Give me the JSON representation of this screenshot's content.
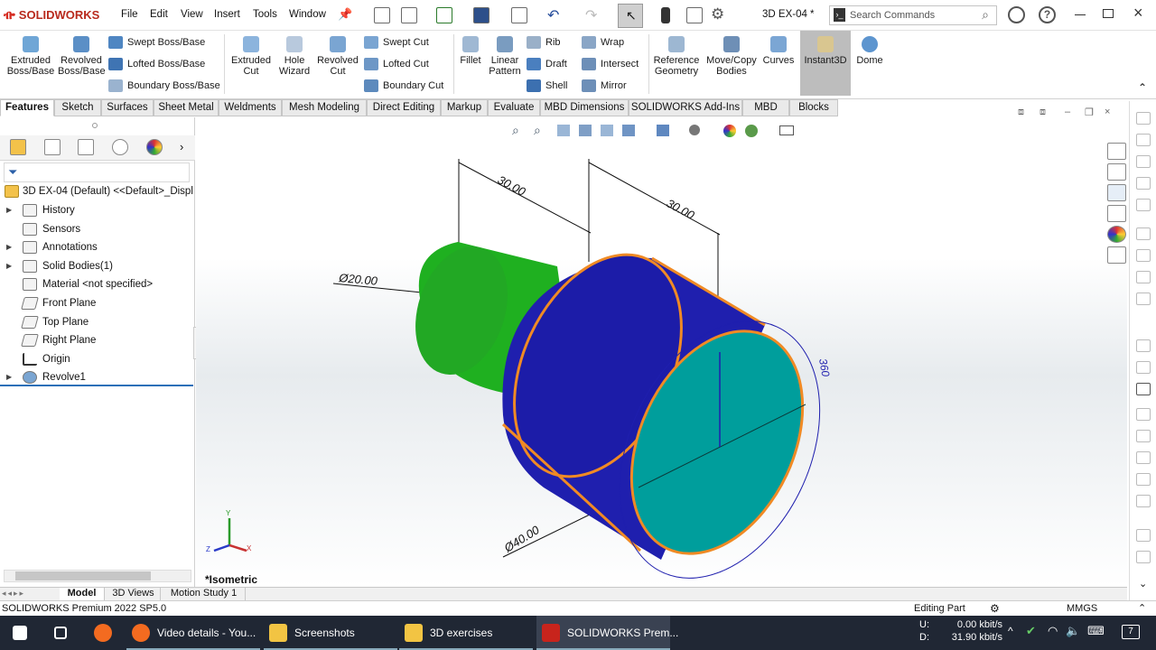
{
  "app": {
    "brand": "SOLIDWORKS",
    "doc_title": "3D EX-04 *"
  },
  "menu": [
    "File",
    "Edit",
    "View",
    "Insert",
    "Tools",
    "Window"
  ],
  "search": {
    "placeholder": "Search Commands"
  },
  "ribbon": {
    "extruded_boss": "Extruded Boss/Base",
    "revolved_boss": "Revolved Boss/Base",
    "swept_boss": "Swept Boss/Base",
    "lofted_boss": "Lofted Boss/Base",
    "boundary_boss": "Boundary Boss/Base",
    "extruded_cut": "Extruded Cut",
    "hole_wizard": "Hole Wizard",
    "revolved_cut": "Revolved Cut",
    "swept_cut": "Swept Cut",
    "lofted_cut": "Lofted Cut",
    "boundary_cut": "Boundary Cut",
    "fillet": "Fillet",
    "linear_pattern": "Linear Pattern",
    "rib": "Rib",
    "draft": "Draft",
    "shell": "Shell",
    "wrap": "Wrap",
    "intersect": "Intersect",
    "mirror": "Mirror",
    "reference_geometry": "Reference Geometry",
    "move_copy": "Move/Copy Bodies",
    "curves": "Curves",
    "instant3d": "Instant3D",
    "dome": "Dome"
  },
  "tabs": [
    "Features",
    "Sketch",
    "Surfaces",
    "Sheet Metal",
    "Weldments",
    "Mesh Modeling",
    "Direct Editing",
    "Markup",
    "Evaluate",
    "MBD Dimensions",
    "SOLIDWORKS Add-Ins",
    "MBD",
    "Blocks"
  ],
  "tree": {
    "root": "3D EX-04 (Default) <<Default>_Displa",
    "items": [
      "History",
      "Sensors",
      "Annotations",
      "Solid Bodies(1)",
      "Material <not specified>",
      "Front Plane",
      "Top Plane",
      "Right Plane",
      "Origin",
      "Revolve1"
    ]
  },
  "viewport": {
    "view_label": "*Isometric",
    "dims": {
      "d1": "30.00",
      "d2": "30.00",
      "dia_small": "Ø20.00",
      "dia_large": "Ø40.00",
      "angle": "360"
    }
  },
  "triad": {
    "x": "X",
    "y": "Y",
    "z": "Z"
  },
  "bottom_tabs": [
    "Model",
    "3D Views",
    "Motion Study 1"
  ],
  "status": {
    "version": "SOLIDWORKS Premium 2022 SP5.0",
    "mode": "Editing Part",
    "units": "MMGS"
  },
  "taskbar": {
    "items": [
      "Video details - You...",
      "Screenshots",
      "3D exercises",
      "SOLIDWORKS Prem..."
    ],
    "net_up_label": "U:",
    "net_down_label": "D:",
    "net_up": "0.00 kbit/s",
    "net_down": "31.90 kbit/s",
    "notif": "7"
  },
  "colors": {
    "accent": "#d52a1f",
    "body_blue": "#1f1fae",
    "face_teal": "#009e9c",
    "shaft_green": "#1fb020",
    "edge_orange": "#f08a24"
  }
}
